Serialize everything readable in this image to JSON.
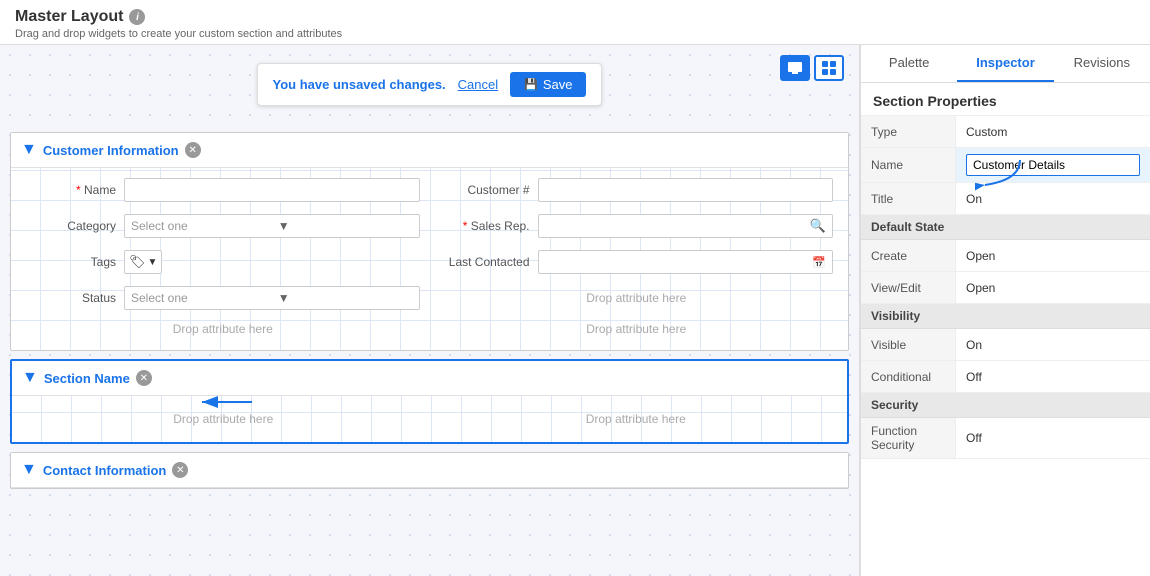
{
  "page": {
    "title": "Master Layout",
    "subtitle": "Drag and drop widgets to create your custom section and attributes"
  },
  "unsaved": {
    "message": "You have unsaved changes.",
    "cancel_label": "Cancel",
    "save_label": "Save"
  },
  "sections": [
    {
      "id": "customer-information",
      "title": "Customer Information",
      "highlighted": false,
      "fields": [
        {
          "label": "Name",
          "required": true,
          "type": "text",
          "placeholder": "",
          "col": "left"
        },
        {
          "label": "Customer #",
          "required": false,
          "type": "text",
          "placeholder": "",
          "col": "right"
        },
        {
          "label": "Category",
          "required": false,
          "type": "select",
          "placeholder": "Select one",
          "col": "left"
        },
        {
          "label": "Sales Rep.",
          "required": true,
          "type": "search",
          "placeholder": "",
          "col": "right"
        },
        {
          "label": "Tags",
          "required": false,
          "type": "tags",
          "col": "left"
        },
        {
          "label": "Last Contacted",
          "required": false,
          "type": "date",
          "col": "right"
        },
        {
          "label": "Status",
          "required": false,
          "type": "select",
          "placeholder": "Select one",
          "col": "left"
        }
      ],
      "drop_left": "Drop attribute here",
      "drop_right": "Drop attribute here",
      "drop_right2": "Drop attribute here"
    },
    {
      "id": "section-name",
      "title": "Section Name",
      "highlighted": true,
      "drop_left": "Drop attribute here",
      "drop_right": "Drop attribute here"
    },
    {
      "id": "contact-information",
      "title": "Contact Information",
      "highlighted": false
    }
  ],
  "right_panel": {
    "tabs": [
      {
        "id": "palette",
        "label": "Palette",
        "active": false
      },
      {
        "id": "inspector",
        "label": "Inspector",
        "active": true
      },
      {
        "id": "revisions",
        "label": "Revisions",
        "active": false
      }
    ],
    "properties_title": "Section Properties",
    "properties": [
      {
        "label": "Type",
        "value": "Custom",
        "type": "text"
      },
      {
        "label": "Name",
        "value": "Customer Details",
        "type": "input"
      },
      {
        "label": "Title",
        "value": "On",
        "type": "text"
      }
    ],
    "default_state_header": "Default State",
    "default_state": [
      {
        "label": "Create",
        "value": "Open"
      },
      {
        "label": "View/Edit",
        "value": "Open"
      }
    ],
    "visibility_header": "Visibility",
    "visibility": [
      {
        "label": "Visible",
        "value": "On"
      },
      {
        "label": "Conditional",
        "value": "Off"
      }
    ],
    "security_header": "Security",
    "security": [
      {
        "label": "Function Security",
        "value": "Off"
      }
    ]
  }
}
